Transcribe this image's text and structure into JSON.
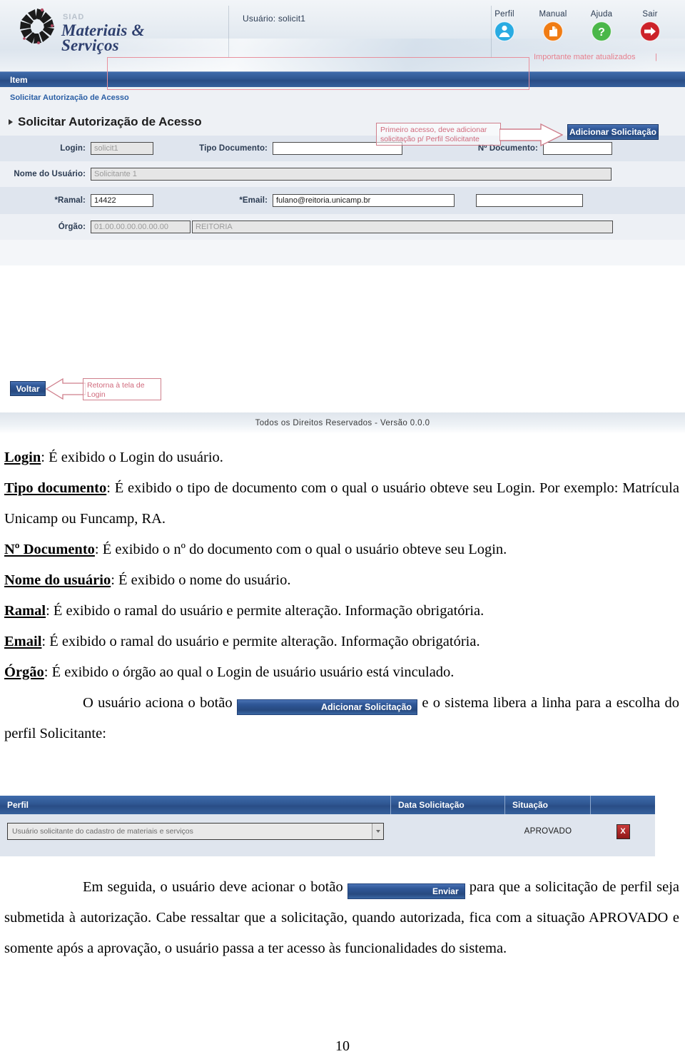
{
  "app": {
    "logo": {
      "siad": "SIAD",
      "line1": "Materiais &",
      "line2": "Serviços"
    },
    "user_label": "Usuário: solicit1",
    "actions": [
      {
        "label": "Perfil",
        "icon": "user-icon",
        "color": "#29abe2"
      },
      {
        "label": "Manual",
        "icon": "document-icon",
        "color": "#f07c14"
      },
      {
        "label": "Ajuda",
        "icon": "question-icon",
        "color": "#4ab749"
      },
      {
        "label": "Sair",
        "icon": "exit-arrow-icon",
        "color": "#cc2229"
      }
    ],
    "item_bar": "Item",
    "breadcrumb": "Solicitar Autorização de Acesso",
    "section_title": "Solicitar Autorização de Acesso",
    "fields": {
      "login_label": "Login:",
      "login_value": "solicit1",
      "tipo_doc_label": "Tipo Documento:",
      "tipo_doc_value": "",
      "num_doc_label": "Nº Documento:",
      "num_doc_value": "",
      "nome_label": "Nome do Usuário:",
      "nome_value": "Solicitante 1",
      "ramal_label": "*Ramal:",
      "ramal_value": "14422",
      "email_label": "*Email:",
      "email_value": "fulano@reitoria.unicamp.br",
      "orgao_label": "Órgão:",
      "orgao_code": "01.00.00.00.00.00.00",
      "orgao_name": "REITORIA"
    },
    "annotations": {
      "importante": "Importante mater atualizados",
      "primeiro_acesso_l1": "Primeiro acesso, deve adicionar",
      "primeiro_acesso_l2": "solicitação p/ Perfil Solicitante",
      "voltar_l1": "Retorna à tela de",
      "voltar_l2": "Login"
    },
    "add_button": "Adicionar Solicitação",
    "back_button": "Voltar",
    "footer": "Todos os Direitos Reservados - Versão 0.0.0"
  },
  "doc": {
    "p1_term": "Login",
    "p1_text": ": É exibido o Login do usuário.",
    "p2_term": "Tipo documento",
    "p2_text": ": É exibido o tipo de documento com o qual o usuário obteve seu Login. Por exemplo: Matrícula Unicamp ou Funcamp, RA.",
    "p3_term": "Nº Documento",
    "p3_text": ": É exibido o nº do documento com o qual o usuário obteve seu Login.",
    "p4_term": "Nome do usuário",
    "p4_text": ": É exibido o nome do usuário.",
    "p5_term": "Ramal",
    "p5_text": ": É exibido o ramal do usuário e permite alteração. Informação obrigatória.",
    "p6_term": "Email",
    "p6_text": ": É exibido o ramal do usuário e permite alteração. Informação obrigatória.",
    "p7_term": "Órgão",
    "p7_text": ": É exibido o órgão ao qual o Login de usuário usuário está vinculado.",
    "p8_pre": "O usuário aciona o botão ",
    "p8_btn": "Adicionar Solicitação",
    "p8_post": " e o sistema libera a linha para a escolha do perfil Solicitante:",
    "p9_pre": "Em seguida, o usuário deve acionar o botão ",
    "p9_btn": "Enviar",
    "p9_post": " para que a solicitação de perfil seja submetida à autorização. Cabe ressaltar que a solicitação, quando autorizada, fica com a situação APROVADO e somente após a aprovação, o usuário passa a ter acesso às funcionalidades do sistema.",
    "page_number": "10"
  },
  "table": {
    "headers": [
      "Perfil",
      "Data Solicitação",
      "Situação",
      ""
    ],
    "rows": [
      {
        "perfil": "Usuário solicitante do cadastro de materiais e serviços",
        "data": "",
        "situacao": "APROVADO",
        "action": "X"
      }
    ]
  }
}
